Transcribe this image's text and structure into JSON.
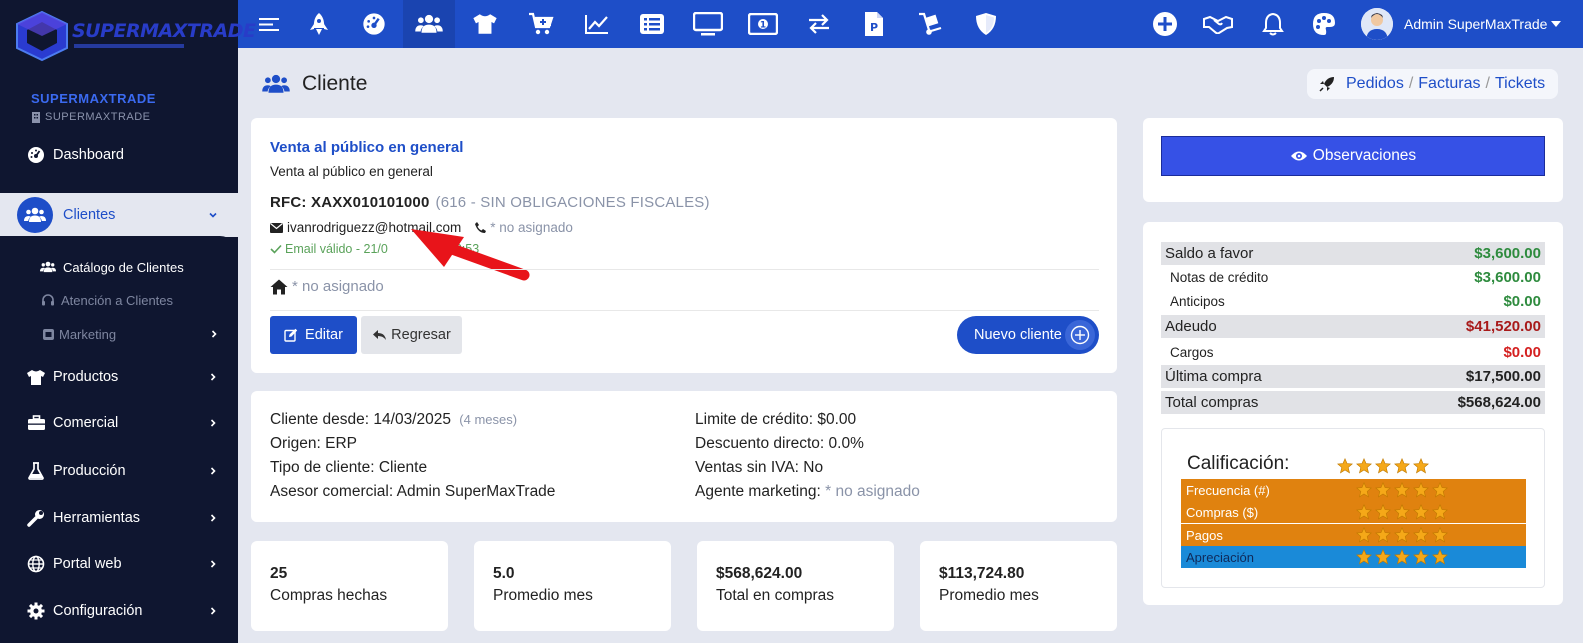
{
  "brand": {
    "logo_text": "SUPERMAXTRADE",
    "company_name": "SUPERMAXTRADE",
    "company_sub": "SUPERMAXTRADE"
  },
  "sidebar": {
    "items": [
      {
        "label": "Dashboard",
        "icon": "gauge-icon"
      },
      {
        "label": "Clientes",
        "icon": "users-icon",
        "active": true
      },
      {
        "label": "Productos",
        "icon": "shirt-icon"
      },
      {
        "label": "Comercial",
        "icon": "briefcase-icon"
      },
      {
        "label": "Producción",
        "icon": "flask-icon"
      },
      {
        "label": "Herramientas",
        "icon": "wrench-icon"
      },
      {
        "label": "Portal web",
        "icon": "globe-icon"
      },
      {
        "label": "Configuración",
        "icon": "gear-icon"
      }
    ],
    "sub_items": [
      {
        "label": "Catálogo de Clientes",
        "icon": "users-icon",
        "active": true
      },
      {
        "label": "Atención a Clientes",
        "icon": "headset-icon"
      },
      {
        "label": "Marketing",
        "icon": "marketing-icon"
      }
    ]
  },
  "topbar": {
    "icons": [
      "menu-icon",
      "rocket-icon",
      "gauge-icon",
      "users-icon",
      "shirt-icon",
      "cart-plus-icon",
      "chart-line-icon",
      "list-icon",
      "desktop-icon",
      "money-icon",
      "exchange-icon",
      "file-p-icon",
      "dolly-icon",
      "shield-icon"
    ],
    "right_icons": [
      "plus-circle-icon",
      "handshake-icon",
      "bell-icon",
      "palette-icon"
    ],
    "user_name": "Admin SuperMaxTrade"
  },
  "page": {
    "title": "Cliente",
    "breadcrumb": [
      "Pedidos",
      "Facturas",
      "Tickets"
    ]
  },
  "client": {
    "name": "Venta al público en general",
    "legal_name": "Venta al público en general",
    "rfc_label": "RFC: XAXX010101000",
    "regime": "(616 - SIN OBLIGACIONES FISCALES)",
    "email": "ivanrodriguezz@hotmail.com",
    "phone": "* no asignado",
    "email_status": "Email válido - 21/0",
    "email_status_tail": "2:53",
    "address": "* no asignado",
    "buttons": {
      "edit": "Editar",
      "back": "Regresar",
      "new": "Nuevo cliente"
    }
  },
  "details": {
    "left": [
      {
        "label": "Cliente desde: 14/03/2025",
        "extra": "(4 meses)"
      },
      {
        "label": "Origen: ERP"
      },
      {
        "label": "Tipo de cliente: Cliente"
      },
      {
        "label": "Asesor comercial: Admin SuperMaxTrade"
      }
    ],
    "right": [
      {
        "label": "Limite de crédito: $0.00"
      },
      {
        "label": "Descuento directo: 0.0%"
      },
      {
        "label": "Ventas sin IVA: No"
      },
      {
        "label": "Agente marketing:",
        "extra": "* no asignado"
      }
    ]
  },
  "stats": [
    {
      "value": "25",
      "label": "Compras hechas"
    },
    {
      "value": "5.0",
      "label": "Promedio mes"
    },
    {
      "value": "$568,624.00",
      "label": "Total en compras"
    },
    {
      "value": "$113,724.80",
      "label": "Promedio mes"
    }
  ],
  "observaciones_label": "Observaciones",
  "balance": [
    {
      "label": "Saldo a favor",
      "value": "$3,600.00",
      "color": "#2e8b3e"
    },
    {
      "label": "Notas de crédito",
      "value": "$3,600.00",
      "color": "#2e8b3e"
    },
    {
      "label": "Anticipos",
      "value": "$0.00",
      "color": "#2e8b3e"
    },
    {
      "label": "Adeudo",
      "value": "$41,520.00",
      "color": "#a81a1a"
    },
    {
      "label": "Cargos",
      "value": "$0.00",
      "color": "#d42020"
    },
    {
      "label": "Última compra",
      "value": "$17,500.00",
      "color": "#222222"
    },
    {
      "label": "Total compras",
      "value": "$568,624.00",
      "color": "#222222"
    }
  ],
  "rating": {
    "title": "Calificación:",
    "stars": 5,
    "rows": [
      {
        "label": "Frecuencia (#)",
        "stars": 5,
        "color": "#e0820f"
      },
      {
        "label": "Compras ($)",
        "stars": 5,
        "color": "#e0820f"
      },
      {
        "label": "Pagos",
        "stars": 5,
        "color": "#e0820f"
      },
      {
        "label": "Apreciación",
        "stars": 5,
        "color": "#1a8ad8"
      }
    ]
  },
  "colors": {
    "primary": "#1e4ec8",
    "sidebar": "#0f1630",
    "accent_orange": "#e0820f",
    "accent_blue": "#1a8ad8",
    "star": "#f5a818"
  }
}
